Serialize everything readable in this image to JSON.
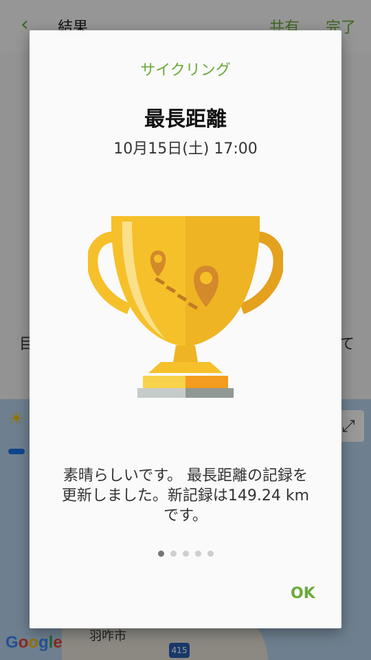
{
  "background": {
    "title": "結果",
    "back_icon": "‹",
    "share_label": "共有",
    "done_label": "完了",
    "text_left": "目",
    "text_right": "て",
    "map": {
      "google_label": "Google",
      "city_label": "羽咋市",
      "road_number": "415"
    }
  },
  "dialog": {
    "category": "サイクリング",
    "record_title": "最長距離",
    "datetime": "10月15日(土) 17:00",
    "message": "素晴らしいです。 最長距離の記録を更新しました。新記録は149.24 kmです。",
    "ok_label": "OK",
    "page_indicator": {
      "count": 5,
      "active_index": 0
    }
  },
  "colors": {
    "accent": "#6aaa3a",
    "trophy_gold": "#f6c02a",
    "trophy_dark": "#e3a11e"
  }
}
